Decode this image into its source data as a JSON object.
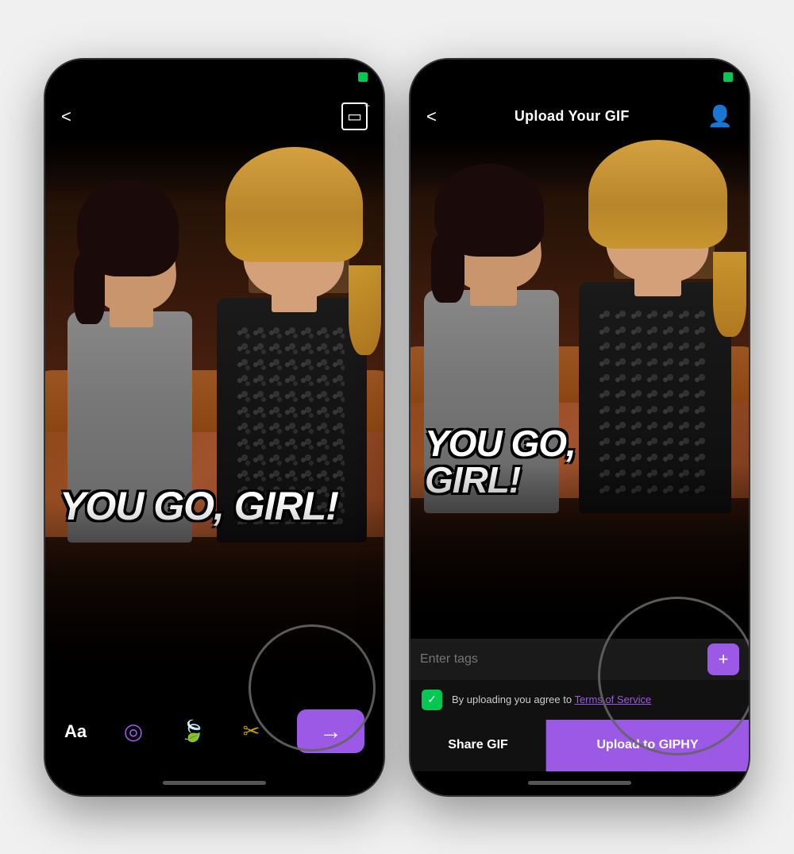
{
  "phone1": {
    "status_battery": "",
    "nav": {
      "back_label": "<",
      "crop_icon": "⊞",
      "title": ""
    },
    "gif_text": "YOU GO,\nGIRL!",
    "toolbar": {
      "text_tool": "Aa",
      "sticker_tool": "◎",
      "leaf_tool": "🍃",
      "scissors_tool": "✂",
      "next_arrow": "→"
    }
  },
  "phone2": {
    "status_battery": "",
    "nav": {
      "back_label": "<",
      "title": "Upload Your GIF",
      "profile_icon": "👤"
    },
    "gif_text": "YOU GO,\nGIRL!",
    "tags": {
      "placeholder": "Enter tags",
      "add_label": "+"
    },
    "terms": {
      "checkbox_checked": true,
      "text": "By uploading you agree to",
      "link_text": "Terms of Service"
    },
    "actions": {
      "share_label": "Share GIF",
      "upload_label": "Upload to GIPHY"
    }
  },
  "colors": {
    "accent": "#9b59e6",
    "green": "#00c853",
    "gold": "#c8a000",
    "black": "#000000",
    "text_white": "#ffffff"
  }
}
